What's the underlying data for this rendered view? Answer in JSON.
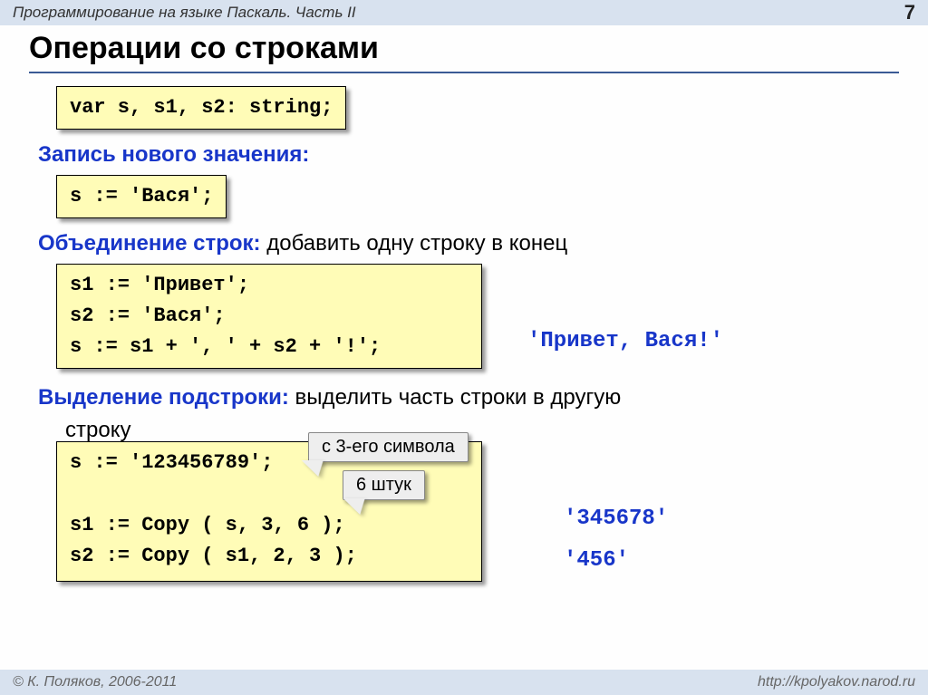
{
  "header": {
    "title": "Программирование на языке Паскаль. Часть II",
    "page": "7"
  },
  "h1": "Операции со строками",
  "code1": "var s, s1, s2: string;",
  "section1": {
    "label": "Запись нового значения:"
  },
  "code2": "s := 'Вася';",
  "section2": {
    "label": "Объединение строк:",
    "plain": " добавить одну строку в конец"
  },
  "code3": "s1 := 'Привет';\ns2 := 'Вася';\ns := s1 + ', ' + s2 + '!';",
  "result3": "'Привет, Вася!'",
  "section3": {
    "label": "Выделение подстроки:",
    "plain": " выделить часть строки в другую",
    "plain2": "строку"
  },
  "code4": "s := '123456789';\n\ns1 := Copy ( s, 3, 6 );\ns2 := Copy ( s1, 2, 3 );",
  "result4a": "'345678'",
  "result4b": "'456'",
  "callout1": "с 3-его символа",
  "callout2": "6 штук",
  "footer": {
    "left": "© К. Поляков, 2006-2011",
    "right": "http://kpolyakov.narod.ru"
  }
}
